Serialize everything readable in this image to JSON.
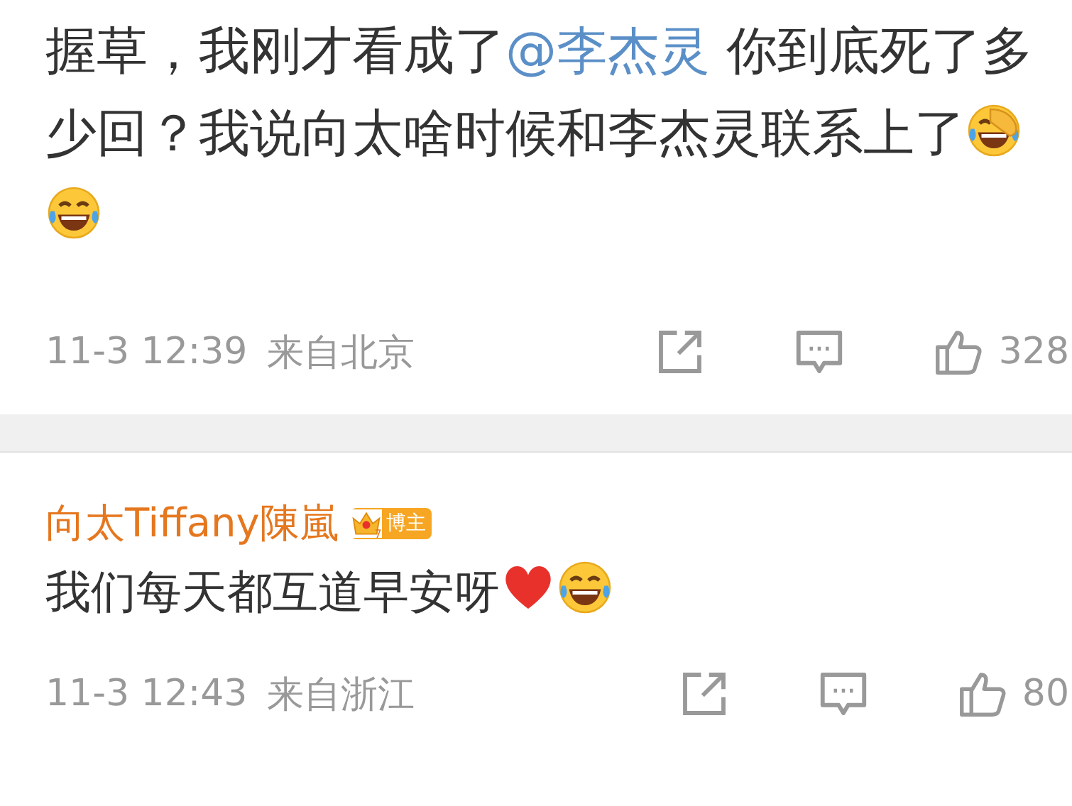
{
  "comments": [
    {
      "content": [
        {
          "kind": "text",
          "text": "握草，我刚才看成了"
        },
        {
          "kind": "mention",
          "text": "@李杰灵"
        },
        {
          "kind": "text",
          "text": " 你到底死了多少回？我说向太啥时候和李杰灵联系上了"
        },
        {
          "kind": "facepalm"
        },
        {
          "kind": "laugh"
        }
      ],
      "time": "11-3 12:39",
      "source": "来自北京",
      "likes": "328"
    },
    {
      "author": "向太Tiffany陳嵐",
      "badge": {
        "rank": "7",
        "label": "博主"
      },
      "content": [
        {
          "kind": "text",
          "text": "我们每天都互道早安呀"
        },
        {
          "kind": "heart"
        },
        {
          "kind": "laugh"
        }
      ],
      "time": "11-3 12:43",
      "source": "来自浙江",
      "likes": "80"
    }
  ]
}
